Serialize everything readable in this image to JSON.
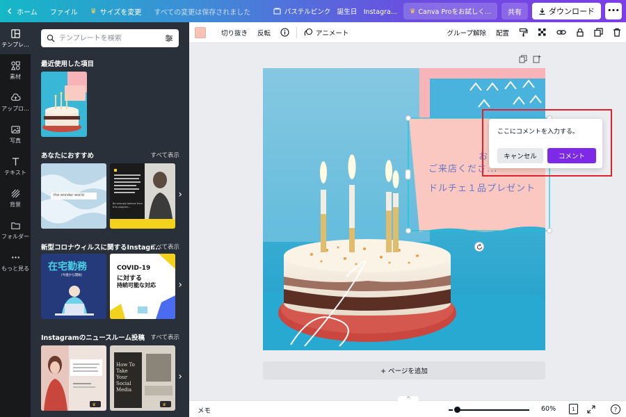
{
  "topbar": {
    "home": "ホーム",
    "file": "ファイル",
    "resize": "サイズを変更",
    "save_status": "すべての変更は保存されました",
    "design_title": "パステルピンク　誕生日　Instagra...",
    "pro_button": "Canva Proをお試しく...",
    "share_button": "共有",
    "download_button": "ダウンロード",
    "more_button": "•••"
  },
  "rail": {
    "items": [
      {
        "label": "テンプレ...",
        "icon": "template-icon"
      },
      {
        "label": "素材",
        "icon": "elements-icon"
      },
      {
        "label": "アップロ...",
        "icon": "upload-icon"
      },
      {
        "label": "写真",
        "icon": "photo-icon"
      },
      {
        "label": "テキスト",
        "icon": "text-icon"
      },
      {
        "label": "背景",
        "icon": "background-icon"
      },
      {
        "label": "フォルダー",
        "icon": "folder-icon"
      },
      {
        "label": "もっと見る",
        "icon": "more-icon"
      }
    ]
  },
  "panel": {
    "search_placeholder": "テンプレートを検索",
    "recent_title": "最近使用した項目",
    "recommend_title": "あなたにおすすめ",
    "covid_title": "新型コロナウィルスに関するInstagr...",
    "news_title": "Instagramのニュースルーム投稿",
    "see_all": "すべて表示",
    "thumb_text": {
      "ocean": "the wonder world",
      "quote": "Be strongly believe from this program...",
      "remote": "在宅勤務",
      "remote_sub": "（今週から開始）",
      "covid_head": "COVID-19",
      "covid_l1": "に対する",
      "covid_l2": "持続可能な対応",
      "news_head": "How To Take Your Social Media"
    }
  },
  "toolbar": {
    "crop": "切り抜き",
    "flip": "反転",
    "animate": "アニメート",
    "ungroup": "グループ解除",
    "arrange": "配置"
  },
  "design": {
    "line1": "お...",
    "line2": "ご来店くださ...",
    "line3": "ドルチェ１品プレゼント"
  },
  "comment": {
    "placeholder": "ここにコメントを入力する。",
    "cancel": "キャンセル",
    "submit": "コメント"
  },
  "canvas": {
    "add_page": "+ ページを追加"
  },
  "bottombar": {
    "memo": "メモ",
    "zoom": "60%",
    "page_number": "1",
    "help": "?"
  },
  "colors": {
    "accent": "#7d2ae8",
    "highlight": "#e0202a",
    "swatch": "#f7c3b6"
  }
}
